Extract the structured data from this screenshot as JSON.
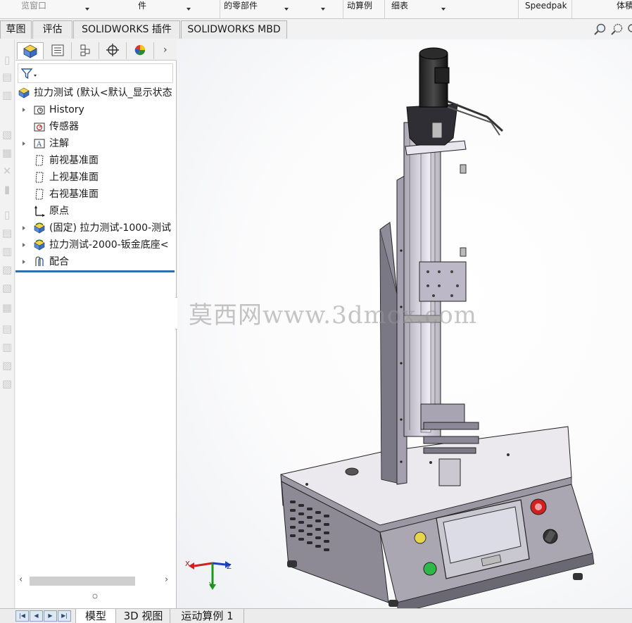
{
  "ribbon": {
    "items": [
      "览窗口",
      "件",
      "的零部件",
      "动算例",
      "细表",
      "Speedpak",
      "体積"
    ]
  },
  "command_tabs": [
    "草图",
    "评估",
    "SOLIDWORKS 插件",
    "SOLIDWORKS MBD"
  ],
  "feature_tree": {
    "root": "拉力测试  (默认<默认_显示状态",
    "items": [
      {
        "label": "History",
        "icon": "history-folder-icon",
        "expandable": true
      },
      {
        "label": "传感器",
        "icon": "sensor-icon",
        "expandable": false
      },
      {
        "label": "注解",
        "icon": "annotation-icon",
        "expandable": true
      },
      {
        "label": "前视基准面",
        "icon": "plane-icon",
        "expandable": false
      },
      {
        "label": "上视基准面",
        "icon": "plane-icon",
        "expandable": false
      },
      {
        "label": "右视基准面",
        "icon": "plane-icon",
        "expandable": false
      },
      {
        "label": "原点",
        "icon": "origin-icon",
        "expandable": false
      },
      {
        "label": "(固定) 拉力测试-1000-测试",
        "icon": "part-icon",
        "expandable": true
      },
      {
        "label": "拉力测试-2000-钣金底座<",
        "icon": "part-icon",
        "expandable": true
      },
      {
        "label": "配合",
        "icon": "mates-icon",
        "expandable": true
      }
    ]
  },
  "graphics": {
    "watermark": "莫西网www.3dmox.com",
    "triad": {
      "x": "X",
      "y": "Y",
      "z": "Z"
    }
  },
  "bottom_tabs": [
    "模型",
    "3D 视图",
    "运动算例 1"
  ],
  "colors": {
    "accent": "#2f6fb0",
    "tree_end_line": "#2f6fb0",
    "estop": "#d22020",
    "green_button": "#2fb84a",
    "yellow_button": "#e8d64a"
  }
}
